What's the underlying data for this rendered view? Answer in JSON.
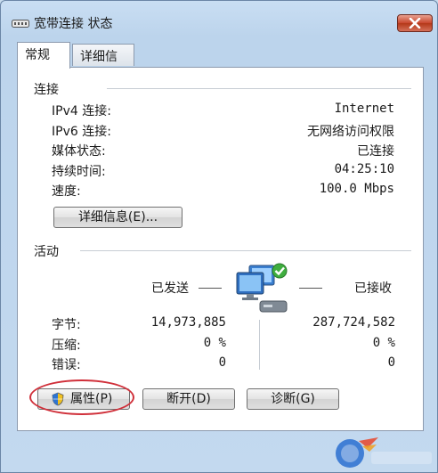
{
  "window": {
    "title": "宽带连接 状态"
  },
  "tabs": [
    {
      "label": "常规",
      "active": true
    },
    {
      "label": "详细信息",
      "active": false
    }
  ],
  "connection": {
    "header": "连接",
    "rows": [
      {
        "label": "IPv4 连接:",
        "value": "Internet"
      },
      {
        "label": "IPv6 连接:",
        "value": "无网络访问权限"
      },
      {
        "label": "媒体状态:",
        "value": "已连接"
      },
      {
        "label": "持续时间:",
        "value": "04:25:10"
      },
      {
        "label": "速度:",
        "value": "100.0 Mbps"
      }
    ],
    "details_button": "详细信息(E)..."
  },
  "activity": {
    "header": "活动",
    "sent_label": "已发送",
    "received_label": "已接收",
    "rows": [
      {
        "label": "字节:",
        "sent": "14,973,885",
        "received": "287,724,582"
      },
      {
        "label": "压缩:",
        "sent": "0 %",
        "received": "0 %"
      },
      {
        "label": "错误:",
        "sent": "0",
        "received": "0"
      }
    ]
  },
  "buttons": {
    "properties": "属性(P)",
    "disconnect": "断开(D)",
    "diagnose": "诊断(G)"
  },
  "colors": {
    "highlight_ellipse": "#d0303a",
    "close_button": "#c8462c"
  }
}
